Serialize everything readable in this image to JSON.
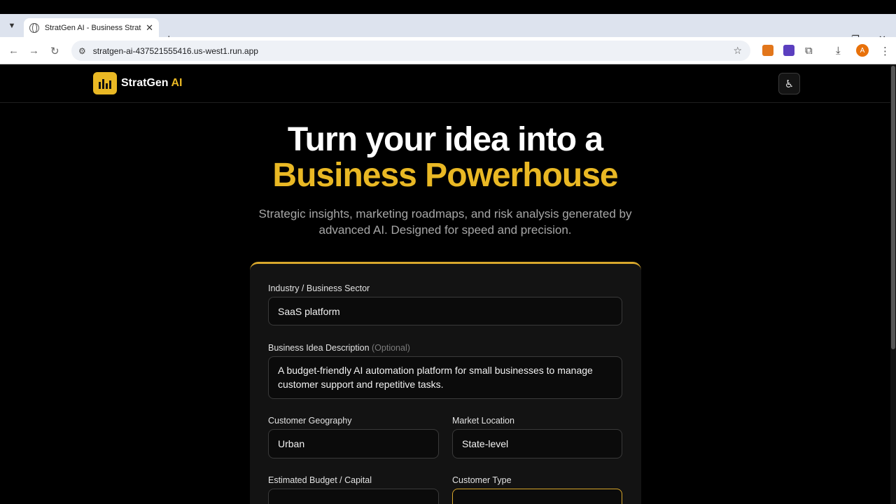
{
  "browser": {
    "tab_title": "StratGen AI - Business Strategy",
    "url": "stratgen-ai-437521555416.us-west1.run.app",
    "profile_initial": "A"
  },
  "app": {
    "brand_name": "StratGen",
    "brand_suffix": "AI",
    "brand_color": "#e9b824",
    "hero_line1": "Turn your idea into a",
    "hero_line2": "Business Powerhouse",
    "subtitle": "Strategic insights, marketing roadmaps, and risk analysis generated by advanced AI. Designed for speed and precision."
  },
  "form": {
    "industry_label": "Industry / Business Sector",
    "industry_value": "SaaS platform",
    "idea_label": "Business Idea Description",
    "idea_optional": "(Optional)",
    "idea_value": "A budget-friendly AI automation platform for small businesses to manage customer support and repetitive tasks.",
    "geography_label": "Customer Geography",
    "geography_value": "Urban",
    "market_label": "Market Location",
    "market_value": "State-level",
    "budget_label": "Estimated Budget / Capital",
    "customer_type_label": "Customer Type"
  }
}
